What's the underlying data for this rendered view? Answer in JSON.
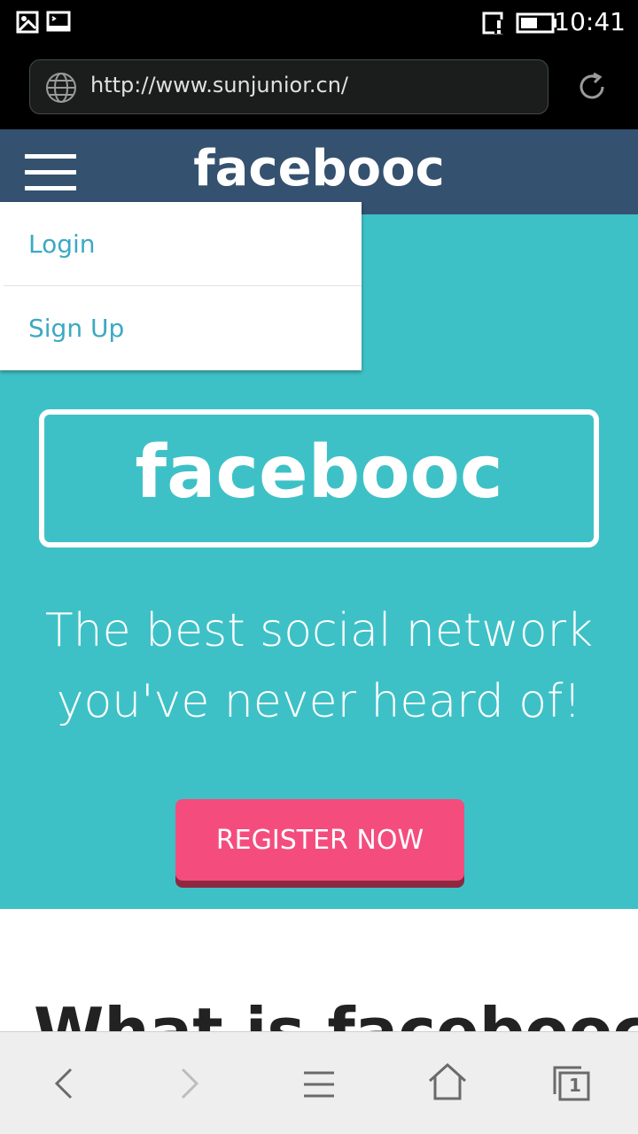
{
  "status_bar": {
    "time": "10:41",
    "icons": [
      "image-icon",
      "terminal-icon",
      "sim-alert-icon",
      "battery-icon"
    ]
  },
  "browser": {
    "url": "http://www.sunjunior.cn/",
    "icons": [
      "globe-icon",
      "refresh-icon"
    ]
  },
  "site": {
    "brand": "facebooc",
    "menu": {
      "items": [
        {
          "label": "Login"
        },
        {
          "label": "Sign Up"
        }
      ]
    },
    "hero": {
      "logo": "facebooc",
      "tagline_line1": "The best social network",
      "tagline_line2": "you've never heard of!",
      "cta": "REGISTER NOW"
    },
    "section_heading": "What is facebooc?"
  },
  "toolbar": {
    "tab_count": "1",
    "icons": [
      "back-icon",
      "forward-icon",
      "menu-icon",
      "home-icon",
      "tabs-icon"
    ]
  },
  "colors": {
    "header_bg": "#34516f",
    "hero_bg": "#3ec1c6",
    "cta_bg": "#f44d7d",
    "menu_text": "#3ba9c4"
  }
}
